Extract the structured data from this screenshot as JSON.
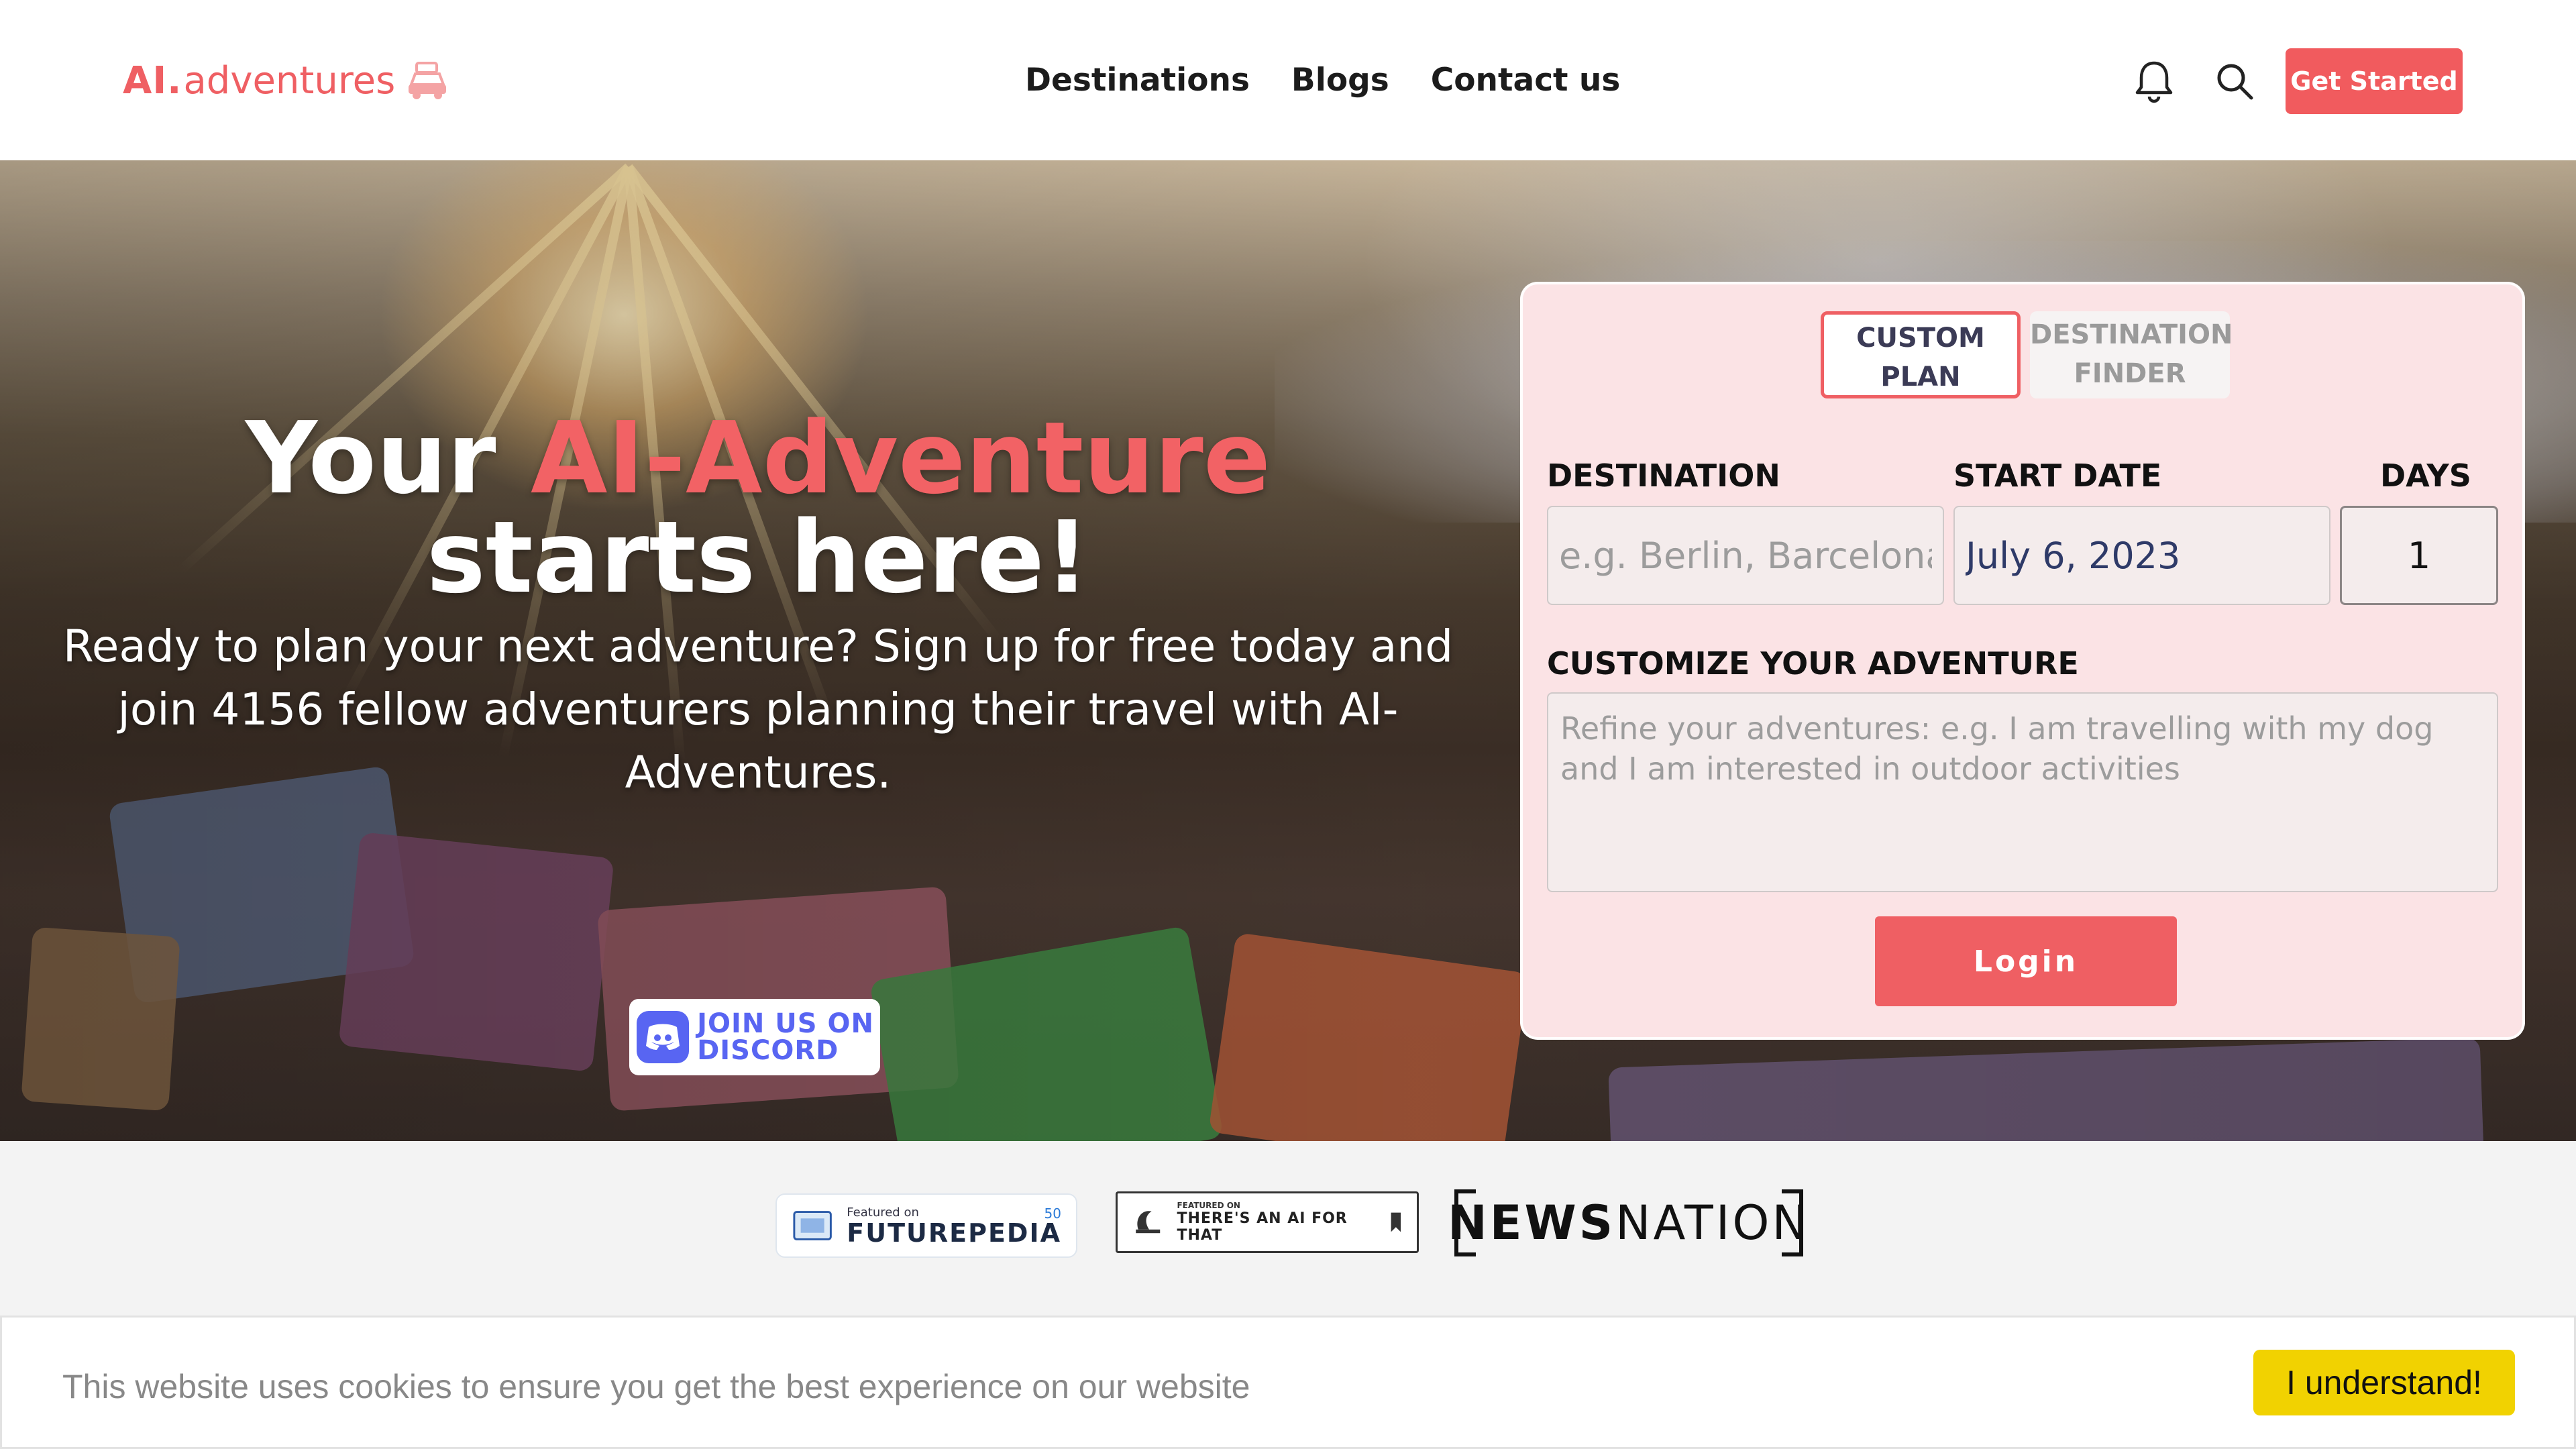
{
  "header": {
    "logo_ai": "AI.",
    "logo_rest": "adventures",
    "nav": [
      "Destinations",
      "Blogs",
      "Contact us"
    ],
    "cta_label": "Get Started",
    "icons": [
      "bell-icon",
      "search-icon"
    ]
  },
  "hero": {
    "title_prefix": "Your",
    "title_accent": "AI-Adventure",
    "title_suffix": "starts here!",
    "subtitle": "Ready to plan your next adventure? Sign up for free today and join 4156 fellow adventurers planning their travel with AI-Adventures.",
    "discord_line1": "JOIN US ON",
    "discord_line2": "DISCORD"
  },
  "planner": {
    "tab_custom": "CUSTOM PLAN",
    "tab_finder": "DESTINATION FINDER",
    "destination_label": "DESTINATION",
    "destination_placeholder": "e.g. Berlin, Barcelona,",
    "start_date_label": "START DATE",
    "start_date_value": "July 6, 2023",
    "days_label": "DAYS",
    "days_value": "1",
    "customize_label": "CUSTOMIZE YOUR ADVENTURE",
    "customize_placeholder": "Refine your adventures: e.g. I am travelling with my dog and I am interested in outdoor activities",
    "login_label": "Login"
  },
  "press": {
    "futurepedia_small": "Featured on",
    "futurepedia_big": "FUTUREPEDIA",
    "futurepedia_count": "50",
    "aiforthat_small": "FEATURED ON",
    "aiforthat_big": "THERE'S AN AI FOR THAT",
    "newsnation_a": "NEWS",
    "newsnation_b": "NATION"
  },
  "cookie": {
    "message": "This website uses cookies to ensure you get the best experience on our website",
    "button": "I understand!"
  },
  "colors": {
    "brand": "#ef5f63",
    "panel_bg": "#fbe3e5",
    "discord": "#5865f2",
    "cookie_button": "#f1d201"
  }
}
